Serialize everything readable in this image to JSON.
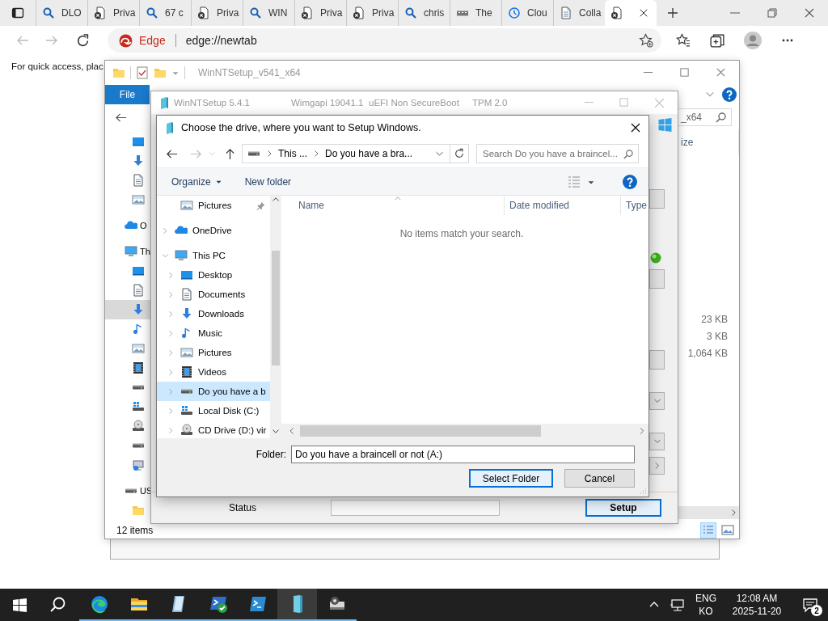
{
  "browser": {
    "tabs": [
      {
        "label": "DLO",
        "kind": "search",
        "selected": false
      },
      {
        "label": "Priva",
        "kind": "private",
        "selected": false
      },
      {
        "label": "67 c",
        "kind": "search",
        "selected": false
      },
      {
        "label": "Priva",
        "kind": "private",
        "selected": false
      },
      {
        "label": "WIN",
        "kind": "search",
        "selected": false
      },
      {
        "label": "Priva",
        "kind": "private",
        "selected": false
      },
      {
        "label": "Priva",
        "kind": "private",
        "selected": false
      },
      {
        "label": "chris",
        "kind": "search",
        "selected": false
      },
      {
        "label": "The",
        "kind": "logo",
        "selected": false
      },
      {
        "label": "Clou",
        "kind": "clock",
        "selected": false
      },
      {
        "label": "Colla",
        "kind": "document",
        "selected": false
      },
      {
        "kind": "private",
        "selected": true
      }
    ],
    "brand": "Edge",
    "url": "edge://newtab",
    "page_text": "For quick access, plac"
  },
  "explorer": {
    "title": "WinNTSetup_v541_x64",
    "ribbon_tab": "File",
    "search_tail": "_x64",
    "column": "ize",
    "sizes": [
      "23 KB",
      "3 KB",
      "1,064 KB"
    ],
    "quick_access": [
      {
        "kind": "desktop",
        "selected": false
      },
      {
        "kind": "download",
        "selected": false
      },
      {
        "kind": "document",
        "selected": false
      },
      {
        "kind": "pictures",
        "selected": false
      }
    ],
    "nav": [
      {
        "text": "O",
        "kind": "onedrive",
        "selected": false
      },
      {
        "text": "Th",
        "kind": "pc",
        "selected": false,
        "children": [
          {
            "kind": "desktop",
            "selected": false
          },
          {
            "kind": "document",
            "selected": false
          },
          {
            "kind": "download",
            "selected": true
          },
          {
            "kind": "music",
            "selected": false
          },
          {
            "kind": "pictures",
            "selected": false
          },
          {
            "kind": "video",
            "selected": false
          },
          {
            "kind": "drive",
            "selected": false
          },
          {
            "kind": "drive-win",
            "selected": false
          },
          {
            "kind": "cd",
            "selected": false
          },
          {
            "kind": "drive",
            "selected": false
          },
          {
            "kind": "net-drive",
            "selected": false
          }
        ]
      },
      {
        "text": "US",
        "kind": "drive",
        "selected": false,
        "children": [
          {
            "kind": "folder",
            "selected": false
          }
        ]
      }
    ],
    "status": "12 items"
  },
  "winntsetup": {
    "title": "WinNTSetup 5.4.1",
    "info": [
      "Wimgapi 19041.1",
      "uEFI Non SecureBoot",
      "TPM 2.0"
    ],
    "status_label": "Status",
    "setup_button": "Setup"
  },
  "dialog": {
    "title": "Choose the drive, where you want to Setup Windows.",
    "breadcrumb": [
      "This ...",
      "Do you have a bra..."
    ],
    "search_placeholder": "Search Do you have a braincel...",
    "toolbar": [
      {
        "label": "Organize",
        "menu": true
      },
      {
        "label": "New folder",
        "menu": false
      }
    ],
    "tree": [
      {
        "label": "Pictures",
        "kind": "pictures",
        "pinned": true,
        "selected": false
      },
      {
        "label": "OneDrive",
        "kind": "onedrive",
        "expanded": false,
        "selected": false
      },
      {
        "label": "This PC",
        "kind": "pc",
        "expanded": true,
        "selected": false,
        "children": [
          {
            "label": "Desktop",
            "kind": "desktop",
            "expanded": false,
            "selected": false
          },
          {
            "label": "Documents",
            "kind": "document",
            "expanded": false,
            "selected": false
          },
          {
            "label": "Downloads",
            "kind": "download",
            "expanded": false,
            "selected": false
          },
          {
            "label": "Music",
            "kind": "music",
            "expanded": false,
            "selected": false
          },
          {
            "label": "Pictures",
            "kind": "pictures",
            "expanded": false,
            "selected": false
          },
          {
            "label": "Videos",
            "kind": "video",
            "expanded": false,
            "selected": false
          },
          {
            "label": "Do you have a b",
            "kind": "drive",
            "expanded": false,
            "selected": true
          },
          {
            "label": "Local Disk (C:)",
            "kind": "drive-win",
            "expanded": false,
            "selected": false
          },
          {
            "label": "CD Drive (D:) vir",
            "kind": "cd",
            "expanded": false,
            "selected": false
          }
        ]
      }
    ],
    "columns": [
      "Name",
      "Date modified",
      "Type"
    ],
    "empty_message": "No items match your search.",
    "folder_label": "Folder:",
    "folder_value": "Do you have a braincell or not (A:)",
    "buttons": [
      {
        "label": "Select Folder",
        "default": true
      },
      {
        "label": "Cancel",
        "default": false
      }
    ]
  },
  "taskbar": {
    "apps": [
      {
        "kind": "browser",
        "running": true,
        "selected": false
      },
      {
        "kind": "folder",
        "running": true,
        "selected": false
      },
      {
        "kind": "slab",
        "running": true,
        "selected": false
      },
      {
        "kind": "terminal-check",
        "running": true,
        "selected": false
      },
      {
        "kind": "terminal",
        "running": true,
        "selected": false
      },
      {
        "kind": "cylinder",
        "running": true,
        "selected": true
      },
      {
        "kind": "disk",
        "running": true,
        "selected": false
      }
    ],
    "language": [
      "ENG",
      "KO"
    ],
    "time": "12:08 AM",
    "date": "2025-11-20",
    "notifications": "2"
  }
}
